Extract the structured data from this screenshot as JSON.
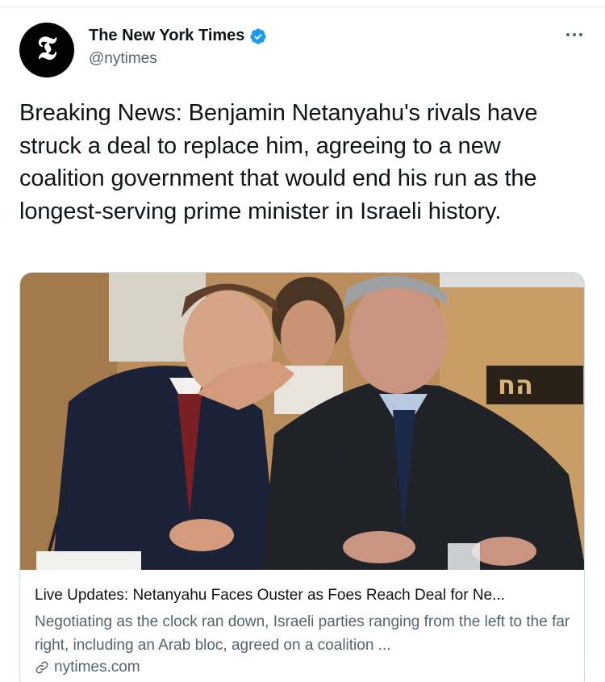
{
  "tweet": {
    "author": {
      "name": "The New York Times",
      "handle": "@nytimes",
      "avatar_glyph": "𝕿",
      "verified": true
    },
    "text": "Breaking News: Benjamin Netanyahu's rivals have struck a deal to replace him, agreeing to a new coalition government that would end his run as the longest-serving prime minister in Israeli history."
  },
  "card": {
    "title": "Live Updates: Netanyahu Faces Ouster as Foes Reach Deal for Ne...",
    "description": "Negotiating as the clock ran down, Israeli parties ranging from the left to the far right, including an Arab bloc, agreed on a coalition ...",
    "domain": "nytimes.com",
    "image_sign_text": "הח"
  },
  "colors": {
    "text_primary": "#0f1419",
    "text_secondary": "#536471",
    "verified_blue": "#1d9bf0",
    "border": "#cfd9de"
  },
  "icons": [
    "verified-icon",
    "more-icon",
    "link-icon"
  ]
}
